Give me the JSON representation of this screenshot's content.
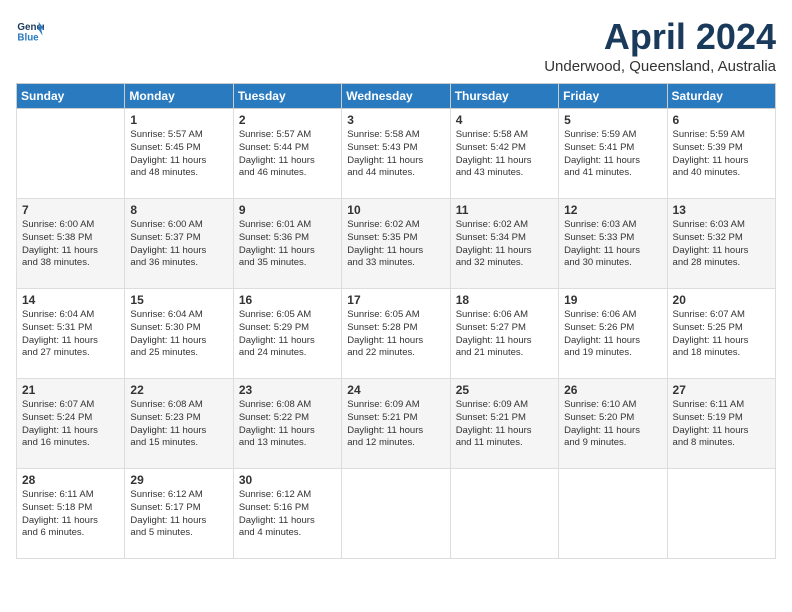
{
  "header": {
    "logo_line1": "General",
    "logo_line2": "Blue",
    "month": "April 2024",
    "location": "Underwood, Queensland, Australia"
  },
  "weekdays": [
    "Sunday",
    "Monday",
    "Tuesday",
    "Wednesday",
    "Thursday",
    "Friday",
    "Saturday"
  ],
  "weeks": [
    [
      {
        "day": "",
        "text": ""
      },
      {
        "day": "1",
        "text": "Sunrise: 5:57 AM\nSunset: 5:45 PM\nDaylight: 11 hours\nand 48 minutes."
      },
      {
        "day": "2",
        "text": "Sunrise: 5:57 AM\nSunset: 5:44 PM\nDaylight: 11 hours\nand 46 minutes."
      },
      {
        "day": "3",
        "text": "Sunrise: 5:58 AM\nSunset: 5:43 PM\nDaylight: 11 hours\nand 44 minutes."
      },
      {
        "day": "4",
        "text": "Sunrise: 5:58 AM\nSunset: 5:42 PM\nDaylight: 11 hours\nand 43 minutes."
      },
      {
        "day": "5",
        "text": "Sunrise: 5:59 AM\nSunset: 5:41 PM\nDaylight: 11 hours\nand 41 minutes."
      },
      {
        "day": "6",
        "text": "Sunrise: 5:59 AM\nSunset: 5:39 PM\nDaylight: 11 hours\nand 40 minutes."
      }
    ],
    [
      {
        "day": "7",
        "text": "Sunrise: 6:00 AM\nSunset: 5:38 PM\nDaylight: 11 hours\nand 38 minutes."
      },
      {
        "day": "8",
        "text": "Sunrise: 6:00 AM\nSunset: 5:37 PM\nDaylight: 11 hours\nand 36 minutes."
      },
      {
        "day": "9",
        "text": "Sunrise: 6:01 AM\nSunset: 5:36 PM\nDaylight: 11 hours\nand 35 minutes."
      },
      {
        "day": "10",
        "text": "Sunrise: 6:02 AM\nSunset: 5:35 PM\nDaylight: 11 hours\nand 33 minutes."
      },
      {
        "day": "11",
        "text": "Sunrise: 6:02 AM\nSunset: 5:34 PM\nDaylight: 11 hours\nand 32 minutes."
      },
      {
        "day": "12",
        "text": "Sunrise: 6:03 AM\nSunset: 5:33 PM\nDaylight: 11 hours\nand 30 minutes."
      },
      {
        "day": "13",
        "text": "Sunrise: 6:03 AM\nSunset: 5:32 PM\nDaylight: 11 hours\nand 28 minutes."
      }
    ],
    [
      {
        "day": "14",
        "text": "Sunrise: 6:04 AM\nSunset: 5:31 PM\nDaylight: 11 hours\nand 27 minutes."
      },
      {
        "day": "15",
        "text": "Sunrise: 6:04 AM\nSunset: 5:30 PM\nDaylight: 11 hours\nand 25 minutes."
      },
      {
        "day": "16",
        "text": "Sunrise: 6:05 AM\nSunset: 5:29 PM\nDaylight: 11 hours\nand 24 minutes."
      },
      {
        "day": "17",
        "text": "Sunrise: 6:05 AM\nSunset: 5:28 PM\nDaylight: 11 hours\nand 22 minutes."
      },
      {
        "day": "18",
        "text": "Sunrise: 6:06 AM\nSunset: 5:27 PM\nDaylight: 11 hours\nand 21 minutes."
      },
      {
        "day": "19",
        "text": "Sunrise: 6:06 AM\nSunset: 5:26 PM\nDaylight: 11 hours\nand 19 minutes."
      },
      {
        "day": "20",
        "text": "Sunrise: 6:07 AM\nSunset: 5:25 PM\nDaylight: 11 hours\nand 18 minutes."
      }
    ],
    [
      {
        "day": "21",
        "text": "Sunrise: 6:07 AM\nSunset: 5:24 PM\nDaylight: 11 hours\nand 16 minutes."
      },
      {
        "day": "22",
        "text": "Sunrise: 6:08 AM\nSunset: 5:23 PM\nDaylight: 11 hours\nand 15 minutes."
      },
      {
        "day": "23",
        "text": "Sunrise: 6:08 AM\nSunset: 5:22 PM\nDaylight: 11 hours\nand 13 minutes."
      },
      {
        "day": "24",
        "text": "Sunrise: 6:09 AM\nSunset: 5:21 PM\nDaylight: 11 hours\nand 12 minutes."
      },
      {
        "day": "25",
        "text": "Sunrise: 6:09 AM\nSunset: 5:21 PM\nDaylight: 11 hours\nand 11 minutes."
      },
      {
        "day": "26",
        "text": "Sunrise: 6:10 AM\nSunset: 5:20 PM\nDaylight: 11 hours\nand 9 minutes."
      },
      {
        "day": "27",
        "text": "Sunrise: 6:11 AM\nSunset: 5:19 PM\nDaylight: 11 hours\nand 8 minutes."
      }
    ],
    [
      {
        "day": "28",
        "text": "Sunrise: 6:11 AM\nSunset: 5:18 PM\nDaylight: 11 hours\nand 6 minutes."
      },
      {
        "day": "29",
        "text": "Sunrise: 6:12 AM\nSunset: 5:17 PM\nDaylight: 11 hours\nand 5 minutes."
      },
      {
        "day": "30",
        "text": "Sunrise: 6:12 AM\nSunset: 5:16 PM\nDaylight: 11 hours\nand 4 minutes."
      },
      {
        "day": "",
        "text": ""
      },
      {
        "day": "",
        "text": ""
      },
      {
        "day": "",
        "text": ""
      },
      {
        "day": "",
        "text": ""
      }
    ]
  ]
}
